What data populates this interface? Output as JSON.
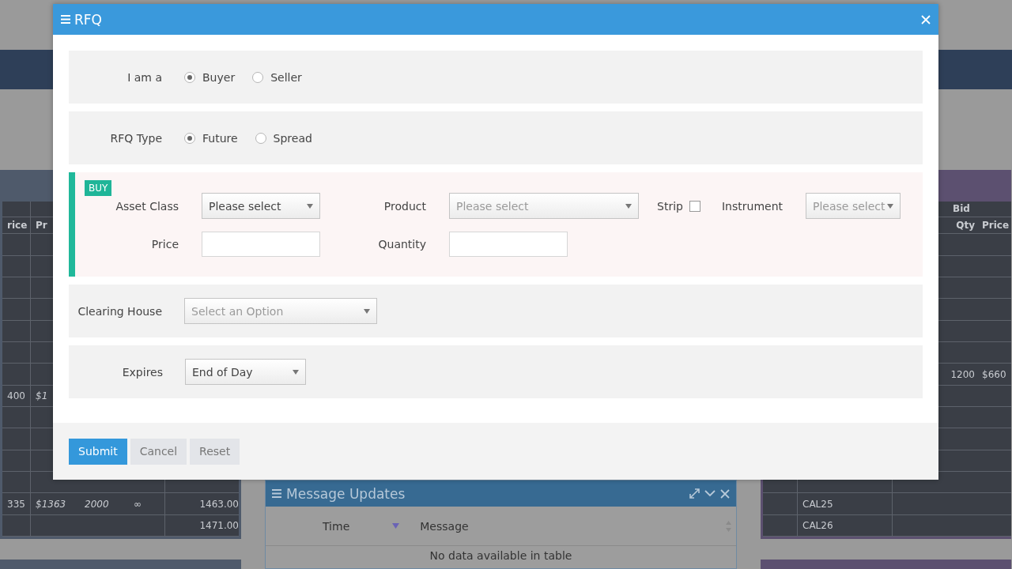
{
  "background": {
    "left_table": {
      "header_cells": {
        "column_1": "rice",
        "column_2": "Pr"
      },
      "rows": [
        {},
        {},
        {},
        {},
        {},
        {},
        {},
        {
          "column_1": "400",
          "column_2": "$1"
        },
        {},
        {},
        {},
        {},
        {
          "column_1": "335",
          "column_2": "$1363",
          "column_3": "2000",
          "column_4": "∞",
          "column_5": "1463.00"
        },
        {
          "column_5": "1471.00"
        }
      ]
    },
    "message_panel": {
      "title": "Message Updates",
      "columns": [
        {
          "label": "Time",
          "sorted": true
        },
        {
          "label": "Message",
          "sorted": false
        }
      ],
      "empty_text": "No data available in table"
    },
    "right_table": {
      "group_header": "Bid",
      "header_cells": {
        "column_3": "Qty",
        "column_4": "Price"
      },
      "rows": [
        {},
        {},
        {},
        {},
        {},
        {},
        {
          "column_3": "1200",
          "column_4": "$660"
        },
        {},
        {},
        {},
        {},
        {},
        {
          "column_2": "CAL25"
        },
        {
          "column_2": "CAL26"
        }
      ]
    }
  },
  "dialog": {
    "title": "RFQ",
    "sections": [
      {
        "kind": "radio",
        "label": "I am a",
        "options": [
          {
            "label": "Buyer",
            "selected": true
          },
          {
            "label": "Seller",
            "selected": false
          }
        ]
      },
      {
        "kind": "radio",
        "label": "RFQ Type",
        "options": [
          {
            "label": "Future",
            "selected": true
          },
          {
            "label": "Spread",
            "selected": false
          }
        ]
      },
      {
        "kind": "order",
        "badge": "BUY",
        "rows": [
          [
            {
              "kind": "select",
              "label": "Asset Class",
              "value": "Please select"
            },
            {
              "kind": "select",
              "label": "Product",
              "placeholder": "Please select"
            },
            {
              "kind": "checkbox",
              "label": "Strip",
              "checked": false
            },
            {
              "kind": "select",
              "label": "Instrument",
              "placeholder": "Please select"
            }
          ],
          [
            {
              "kind": "input",
              "label": "Price"
            },
            {
              "kind": "input",
              "label": "Quantity"
            }
          ]
        ]
      },
      {
        "kind": "select",
        "label": "Clearing House",
        "placeholder": "Select an Option"
      },
      {
        "kind": "select",
        "label": "Expires",
        "value": "End of Day"
      }
    ],
    "buttons": [
      {
        "label": "Submit",
        "primary": true
      },
      {
        "label": "Cancel",
        "primary": false
      },
      {
        "label": "Reset",
        "primary": false
      }
    ]
  }
}
